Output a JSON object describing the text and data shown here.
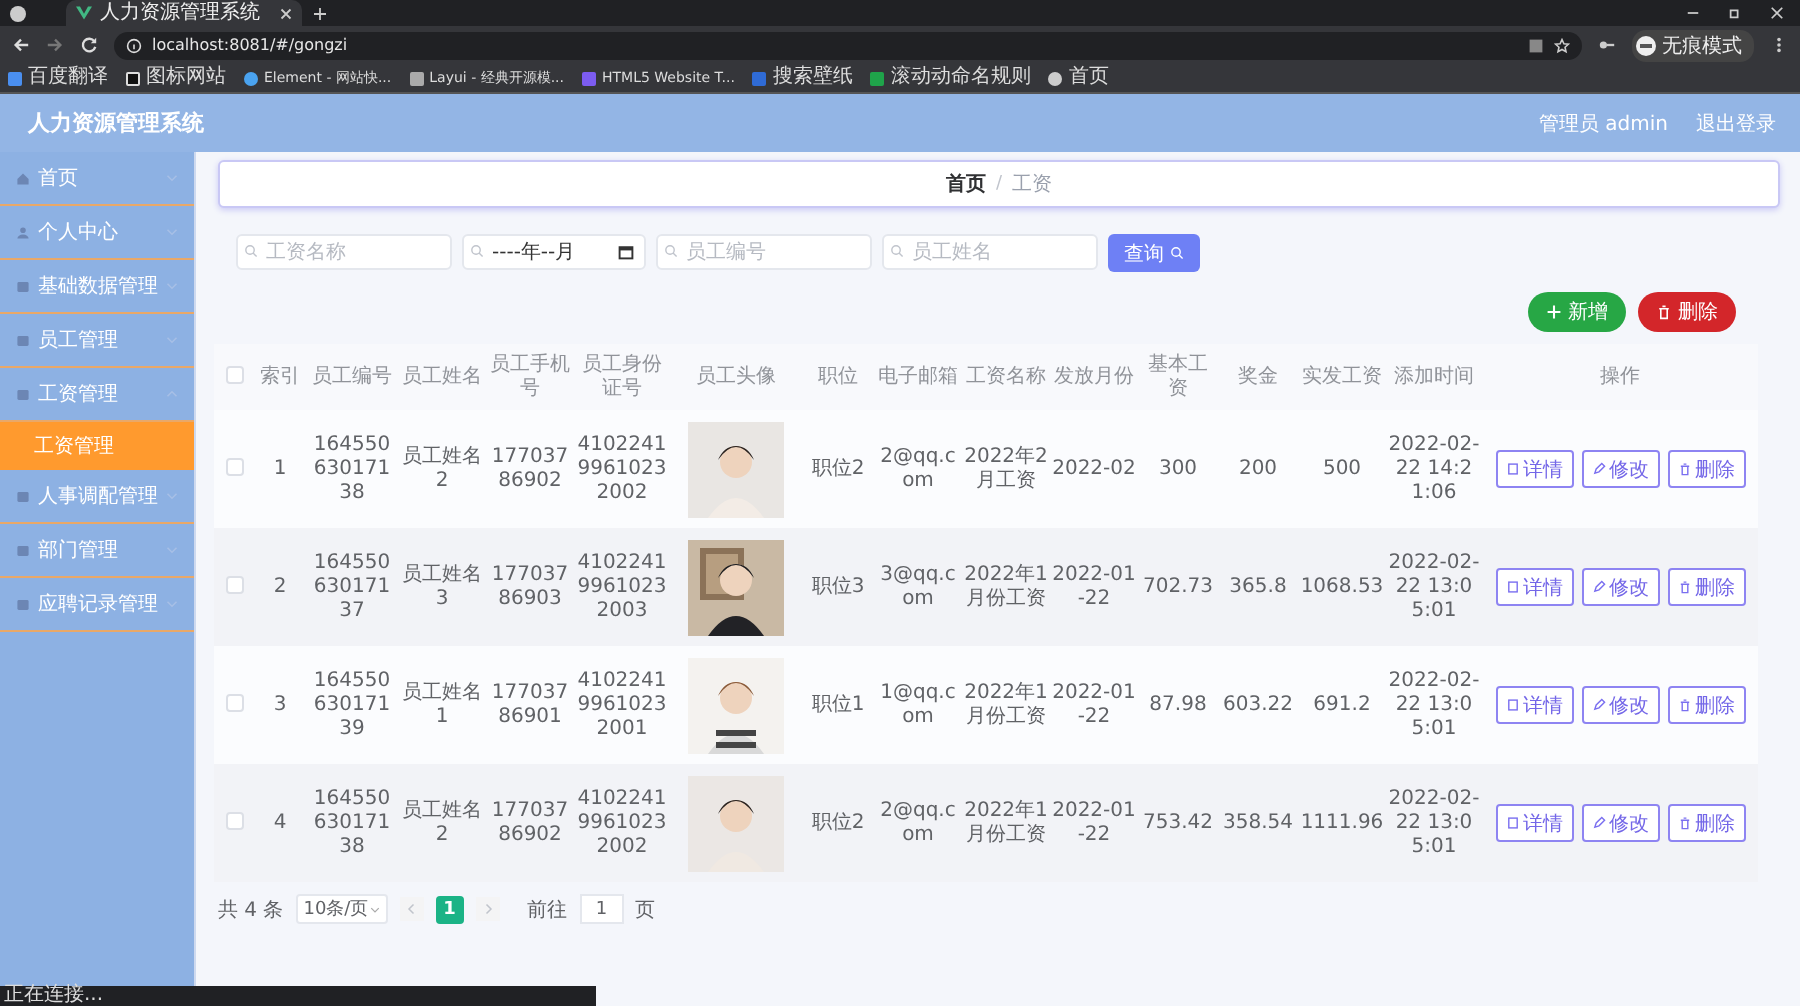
{
  "browser": {
    "tabs": [
      {
        "title": "人力资源管理系统",
        "selected": true
      }
    ],
    "address": "localhost:8081/#/gongzi",
    "bookmarks": [
      "百度翻译",
      "图标网站",
      "Element - 网站快...",
      "Layui - 经典开源模...",
      "HTML5 Website T...",
      "搜索壁纸",
      "滚动动命名规则",
      "首页"
    ],
    "profile": "无痕模式"
  },
  "app": {
    "title": "人力资源管理系统",
    "user": "管理员 admin",
    "logout": "退出登录"
  },
  "sidebar": {
    "items": [
      {
        "label": "首页",
        "selected": false,
        "expanded": false
      },
      {
        "label": "个人中心",
        "selected": false,
        "expanded": false
      },
      {
        "label": "基础数据管理",
        "selected": false,
        "expanded": false
      },
      {
        "label": "员工管理",
        "selected": false,
        "expanded": false
      },
      {
        "label": "工资管理",
        "selected": false,
        "expanded": true,
        "children": [
          {
            "label": "工资管理",
            "selected": true
          }
        ]
      },
      {
        "label": "人事调配管理",
        "selected": false,
        "expanded": false
      },
      {
        "label": "部门管理",
        "selected": false,
        "expanded": false
      },
      {
        "label": "应聘记录管理",
        "selected": false,
        "expanded": false
      }
    ]
  },
  "breadcrumb": [
    "首页",
    "工资"
  ],
  "breadcrumb_separator": "/",
  "filters": [
    {
      "kind": "text",
      "placeholder": "工资名称"
    },
    {
      "kind": "month",
      "placeholder": "----年--月"
    },
    {
      "kind": "text",
      "placeholder": "员工编号"
    },
    {
      "kind": "text",
      "placeholder": "员工姓名"
    }
  ],
  "search_button": "查询",
  "add_button": "新增",
  "delete_button": "删除",
  "table": {
    "select_all_checked": false,
    "columns": [
      "索引",
      "员工编号",
      "员工姓名",
      "员工手机号",
      "员工身份证号",
      "员工头像",
      "职位",
      "电子邮箱",
      "工资名称",
      "发放月份",
      "基本工资",
      "奖金",
      "实发工资",
      "添加时间",
      "操作"
    ],
    "rows": [
      {
        "checked": false,
        "cells": [
          "1",
          "16455063017138",
          "员工姓名2",
          "17703786902",
          "410224199610232002"
        ],
        "photo": {
          "kind": "picture"
        },
        "cells_after": [
          "职位2",
          "2@qq.com",
          "2022年2月工资",
          "2022-02",
          "300",
          "200",
          "500",
          "2022-02-22 14:21:06"
        ],
        "actions": [
          "详情",
          "修改",
          "删除"
        ]
      },
      {
        "checked": false,
        "cells": [
          "2",
          "16455063017137",
          "员工姓名3",
          "17703786903",
          "410224199610232003"
        ],
        "photo": {
          "kind": "picture"
        },
        "cells_after": [
          "职位3",
          "3@qq.com",
          "2022年1月份工资",
          "2022-01-22",
          "702.73",
          "365.8",
          "1068.53",
          "2022-02-22 13:05:01"
        ],
        "actions": [
          "详情",
          "修改",
          "删除"
        ]
      },
      {
        "checked": false,
        "cells": [
          "3",
          "16455063017139",
          "员工姓名1",
          "17703786901",
          "410224199610232001"
        ],
        "photo": {
          "kind": "picture"
        },
        "cells_after": [
          "职位1",
          "1@qq.com",
          "2022年1月份工资",
          "2022-01-22",
          "87.98",
          "603.22",
          "691.2",
          "2022-02-22 13:05:01"
        ],
        "actions": [
          "详情",
          "修改",
          "删除"
        ]
      },
      {
        "checked": false,
        "cells": [
          "4",
          "16455063017138",
          "员工姓名2",
          "17703786902",
          "410224199610232002"
        ],
        "photo": {
          "kind": "picture"
        },
        "cells_after": [
          "职位2",
          "2@qq.com",
          "2022年1月份工资",
          "2022-01-22",
          "753.42",
          "358.54",
          "1111.96",
          "2022-02-22 13:05:01"
        ],
        "actions": [
          "详情",
          "修改",
          "删除"
        ]
      }
    ]
  },
  "pagination": {
    "total": "共 4 条",
    "page_size": "10条/页",
    "pages": [
      {
        "label": "1",
        "selected": true
      }
    ],
    "goto_label": "前往",
    "goto_value": "1",
    "goto_suffix": "页"
  },
  "status_bar": "正在连接..."
}
